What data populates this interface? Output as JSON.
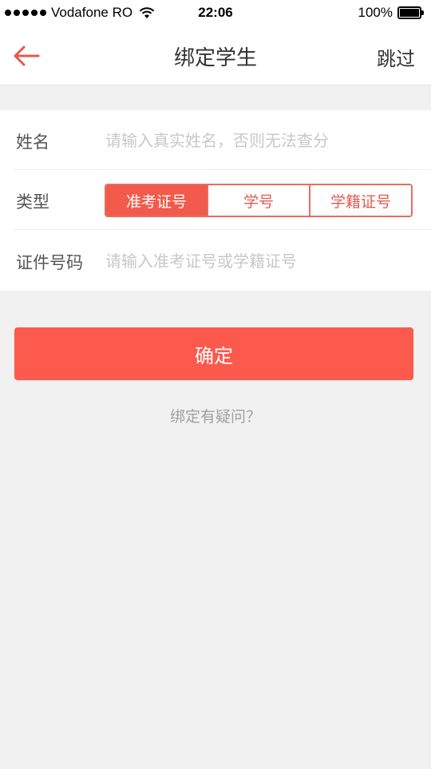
{
  "status_bar": {
    "carrier": "Vodafone RO",
    "time": "22:06",
    "battery": "100%"
  },
  "nav": {
    "title": "绑定学生",
    "skip_label": "跳过"
  },
  "form": {
    "name_label": "姓名",
    "name_placeholder": "请输入真实姓名，否则无法查分",
    "type_label": "类型",
    "type_options": [
      "准考证号",
      "学号",
      "学籍证号"
    ],
    "type_selected": "准考证号",
    "id_label": "证件号码",
    "id_placeholder": "请输入准考证号或学籍证号"
  },
  "confirm_label": "确定",
  "help_label": "绑定有疑问？",
  "colors": {
    "accent": "#fb5a4d",
    "background": "#f2f1f2"
  }
}
